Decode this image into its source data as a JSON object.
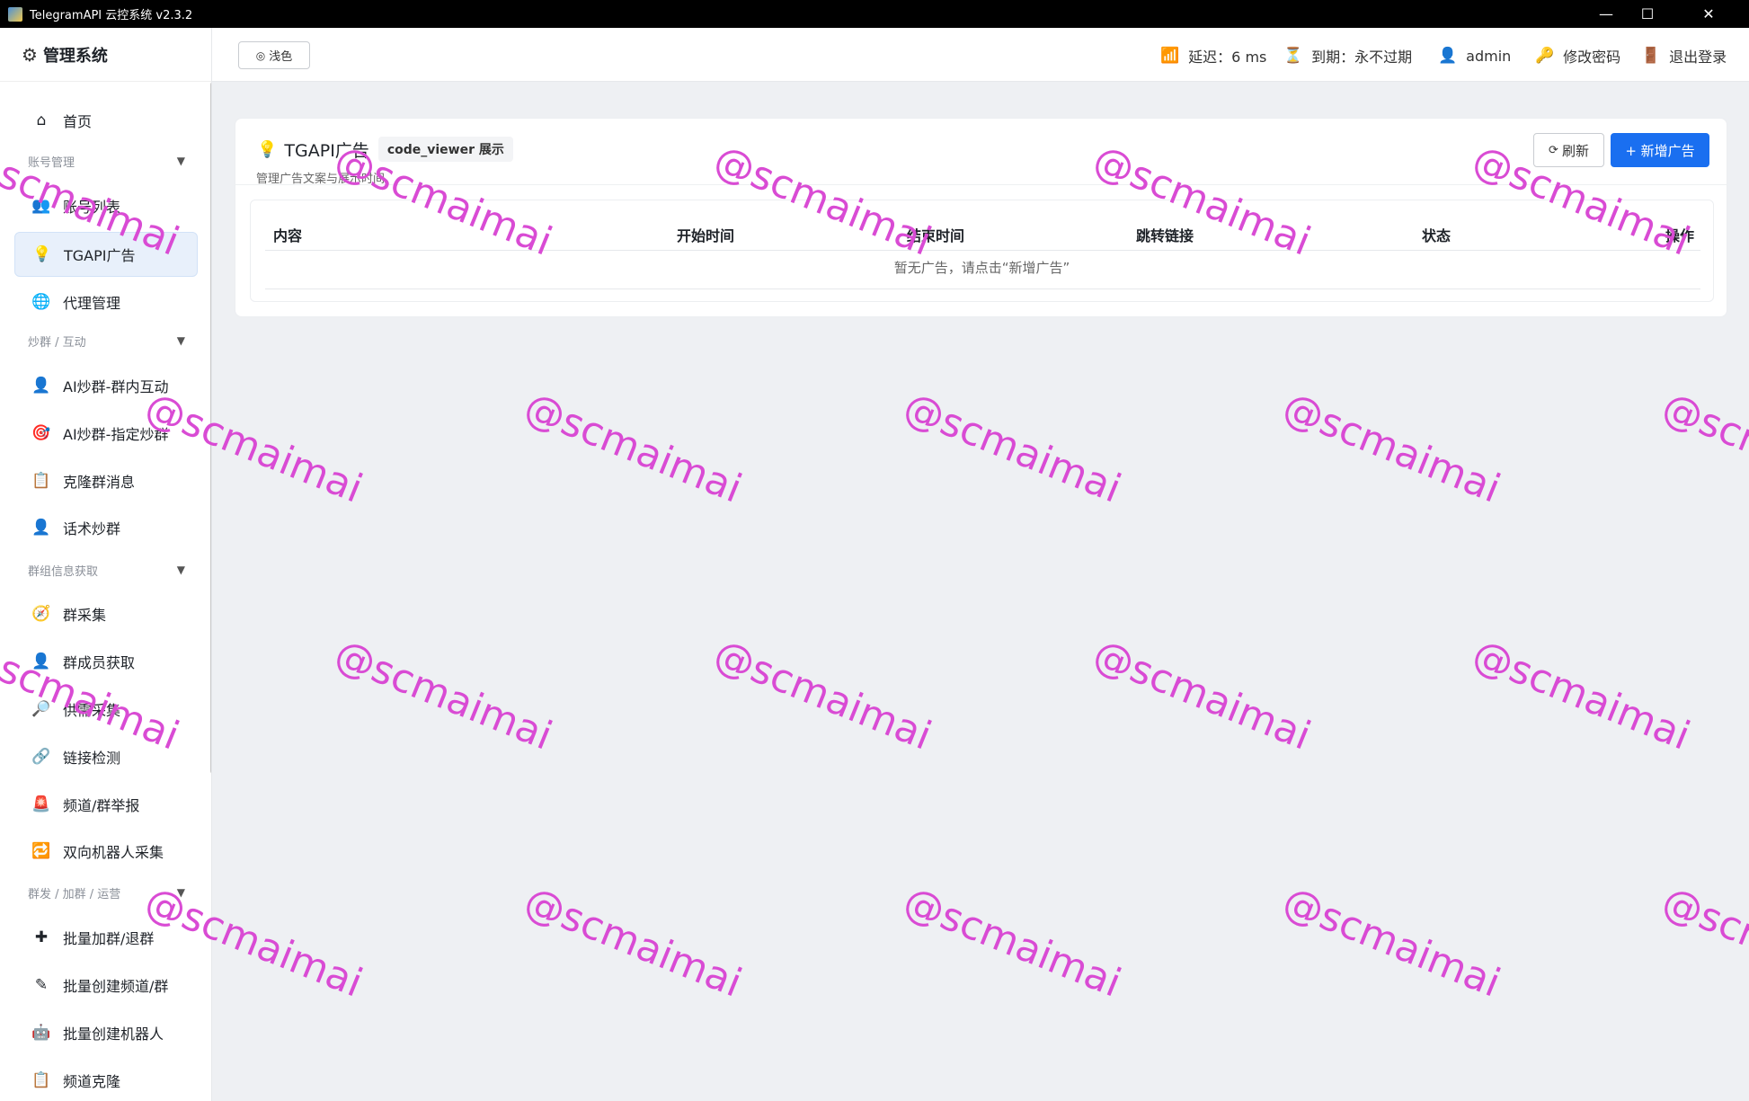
{
  "window": {
    "title": "TelegramAPI 云控系统 v2.3.2",
    "minimize": "—",
    "maximize": "☐",
    "close": "✕"
  },
  "sidebar": {
    "brand": "管理系统",
    "items": [
      {
        "label": "首页",
        "icon": "home-icon",
        "glyph": "⌂"
      },
      {
        "label": "账号列表",
        "icon": "users-icon",
        "glyph": "👥"
      },
      {
        "label": "TGAPI广告",
        "icon": "lightbulb-icon",
        "glyph": "💡"
      },
      {
        "label": "代理管理",
        "icon": "globe-icon",
        "glyph": "🌐"
      },
      {
        "label": "AI炒群-群内互动",
        "icon": "user-icon",
        "glyph": "👤"
      },
      {
        "label": "AI炒群-指定炒群",
        "icon": "target-icon",
        "glyph": "🎯"
      },
      {
        "label": "克隆群消息",
        "icon": "clipboard-icon",
        "glyph": "📋"
      },
      {
        "label": "话术炒群",
        "icon": "user-icon",
        "glyph": "👤"
      },
      {
        "label": "群采集",
        "icon": "compass-icon",
        "glyph": "🧭"
      },
      {
        "label": "群成员获取",
        "icon": "user-icon",
        "glyph": "👤"
      },
      {
        "label": "供需采集",
        "icon": "search-icon",
        "glyph": "🔎"
      },
      {
        "label": "链接检测",
        "icon": "link-icon",
        "glyph": "🔗"
      },
      {
        "label": "频道/群举报",
        "icon": "alarm-icon",
        "glyph": "🚨"
      },
      {
        "label": "双向机器人采集",
        "icon": "repeat-icon",
        "glyph": "🔁"
      },
      {
        "label": "批量加群/退群",
        "icon": "plus-icon",
        "glyph": "✚"
      },
      {
        "label": "批量创建频道/群",
        "icon": "pen-icon",
        "glyph": "✎"
      },
      {
        "label": "批量创建机器人",
        "icon": "robot-icon",
        "glyph": "🤖"
      },
      {
        "label": "频道克隆",
        "icon": "clipboard-icon",
        "glyph": "📋"
      }
    ],
    "groups": [
      {
        "label": "账号管理",
        "caret": "▼"
      },
      {
        "label": "炒群 / 互动",
        "caret": "▼"
      },
      {
        "label": "群组信息获取",
        "caret": "▼"
      },
      {
        "label": "群发 / 加群 / 运营",
        "caret": "▼"
      }
    ]
  },
  "header": {
    "theme_label": "浅色",
    "latency": "延迟：6 ms",
    "expiry": "到期：永不过期",
    "user": "admin",
    "change_password": "修改密码",
    "logout": "退出登录"
  },
  "card": {
    "title": "TGAPI广告",
    "tag": "code_viewer 展示",
    "subtitle": "管理广告文案与展示时间",
    "refresh_label": "刷新",
    "add_label": "+ 新增广告",
    "columns": [
      "内容",
      "开始时间",
      "结束时间",
      "跳转链接",
      "状态",
      "操作"
    ],
    "empty_text": "暂无广告，请点击“新增广告”"
  },
  "watermark": {
    "text": "@scmaimai",
    "color": "#d94bd4"
  },
  "colors": {
    "primary": "#1a6ff0",
    "active_bg": "#e8f0fb"
  }
}
